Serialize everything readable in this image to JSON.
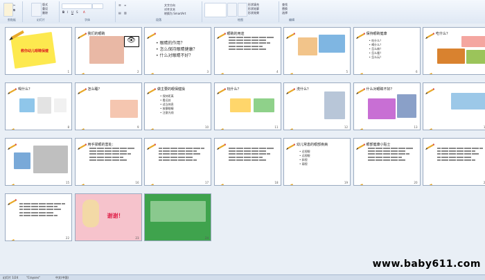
{
  "ribbon": {
    "groups": [
      "剪贴板",
      "幻灯片",
      "字体",
      "段落",
      "绘图",
      "编辑"
    ],
    "buttons": [
      "粘贴",
      "新建幻灯片",
      "版式",
      "重设",
      "删除",
      "文字方向",
      "对齐文本",
      "转换为 SmartArt",
      "排列",
      "快速样式",
      "形状填充",
      "形状轮廓",
      "形状效果",
      "查找",
      "替换",
      "选择"
    ]
  },
  "slides": [
    {
      "num": "1",
      "title": "教你幼儿眼睛保健",
      "type": "cover"
    },
    {
      "num": "2",
      "title": "我们的眼睛",
      "type": "eye"
    },
    {
      "num": "3",
      "title": "",
      "bullets": "• 眼睛的作用？\n• 怎么保持眼睛健康？\n• 什么对眼睛不好？",
      "type": "bullets-big"
    },
    {
      "num": "4",
      "title": "眼睛的用途",
      "type": "para-only"
    },
    {
      "num": "5",
      "title": "",
      "type": "pics"
    },
    {
      "num": "6",
      "title": "保持眼睛健康",
      "bullets": "• 吃什么？\n• 喝什么？\n• 怎么做？\n• 怎么看？\n• 怎么玩？",
      "type": "bullets"
    },
    {
      "num": "7",
      "title": "吃什么？",
      "type": "food"
    },
    {
      "num": "8",
      "title": "喝什么？",
      "type": "drink"
    },
    {
      "num": "9",
      "title": "怎么睡？",
      "type": "sleep"
    },
    {
      "num": "10",
      "title": "做主要的眼保健操",
      "bullets": "• 保持距离\n• 看远处\n• 适当休息\n• 按摩眼睛\n• 注意光线",
      "type": "bullets"
    },
    {
      "num": "11",
      "title": "玩什么？",
      "type": "play"
    },
    {
      "num": "12",
      "title": "洗什么？",
      "type": "wash"
    },
    {
      "num": "13",
      "title": "什么对眼睛不好？",
      "type": "bad"
    },
    {
      "num": "14",
      "title": "",
      "type": "sleepkid"
    },
    {
      "num": "15",
      "title": "",
      "type": "pencils"
    },
    {
      "num": "16",
      "title": "用手揉眼的害处：",
      "type": "para"
    },
    {
      "num": "17",
      "title": "",
      "type": "para"
    },
    {
      "num": "18",
      "title": "",
      "type": "para"
    },
    {
      "num": "19",
      "title": "幼儿常患的眼部疾病",
      "bullets": "• 近视眼\n• 远视眼\n• 斜视\n• 弱视",
      "type": "bullets"
    },
    {
      "num": "20",
      "title": "眼部健康小贴士",
      "type": "para"
    },
    {
      "num": "21",
      "title": "",
      "type": "para"
    },
    {
      "num": "22",
      "title": "",
      "type": "para"
    },
    {
      "num": "23",
      "title": "谢谢！",
      "type": "thanks"
    },
    {
      "num": "24",
      "title": "",
      "type": "green"
    }
  ],
  "status": {
    "slide": "幻灯片 1/24",
    "theme": "\"Crayons\"",
    "lang": "中文(中国)"
  },
  "watermark": "www.baby611.com",
  "colors": {
    "ribbon": "#dfe8f4",
    "canvas": "#e9eff6",
    "green_slide": "#4caf50",
    "pink_slide": "#f8c7cf"
  }
}
